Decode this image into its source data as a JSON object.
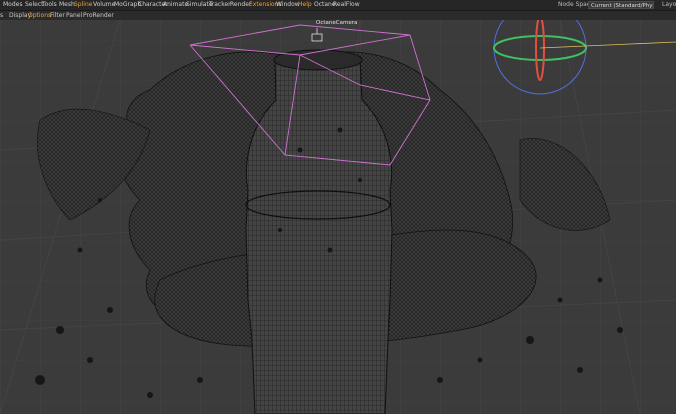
{
  "menubar": {
    "items": [
      "Modes",
      "Select",
      "Tools",
      "Mesh",
      "Spline",
      "Volume",
      "MoGraph",
      "Character",
      "Animate",
      "Simulate",
      "Tracker",
      "Render",
      "Extensions",
      "Window",
      "Help",
      "Octane",
      "RealFlow"
    ],
    "node_space_label": "Node Space:",
    "node_space_value": "Current (Standard/Physical)",
    "layout_label": "Layou"
  },
  "toolbar": {
    "items": [
      "s",
      "Display",
      "Options",
      "Filter",
      "Panel",
      "ProRender"
    ]
  },
  "viewport": {
    "camera_label": "OctaneCamera",
    "icons": [
      "camera-icon",
      "axis-gizmo-icon"
    ],
    "colors": {
      "background": "#3b3b3b",
      "wire": "#111111",
      "camera_frame": "#d070d0",
      "axis_x": "#e05040",
      "axis_y": "#40c060",
      "axis_z": "#5070e0"
    }
  }
}
